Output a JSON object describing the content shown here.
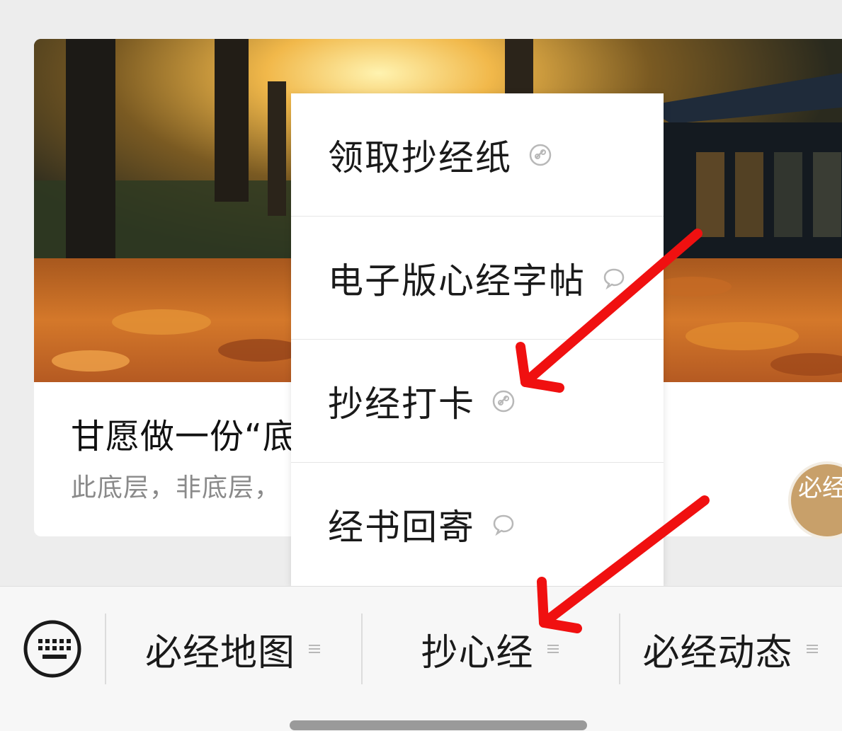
{
  "article": {
    "title": "甘愿做一份“底",
    "subtitle": "此底层，非底层，"
  },
  "float_badge": {
    "text": "必经",
    "color": "#c8a06a"
  },
  "popup_menu": {
    "items": [
      {
        "label": "领取抄经纸",
        "icon": "link-icon"
      },
      {
        "label": "电子版心经字帖",
        "icon": "chat-bubble-icon"
      },
      {
        "label": "抄经打卡",
        "icon": "link-icon"
      },
      {
        "label": "经书回寄",
        "icon": "chat-bubble-icon"
      }
    ]
  },
  "bottom_menu": {
    "keyboard_icon": "keyboard-icon",
    "tabs": [
      {
        "label": "必经地图",
        "icon": "list-icon"
      },
      {
        "label": "抄心经",
        "icon": "list-icon"
      },
      {
        "label": "必经动态",
        "icon": "list-icon"
      }
    ]
  },
  "annotations": {
    "arrow_color": "#f01010"
  }
}
